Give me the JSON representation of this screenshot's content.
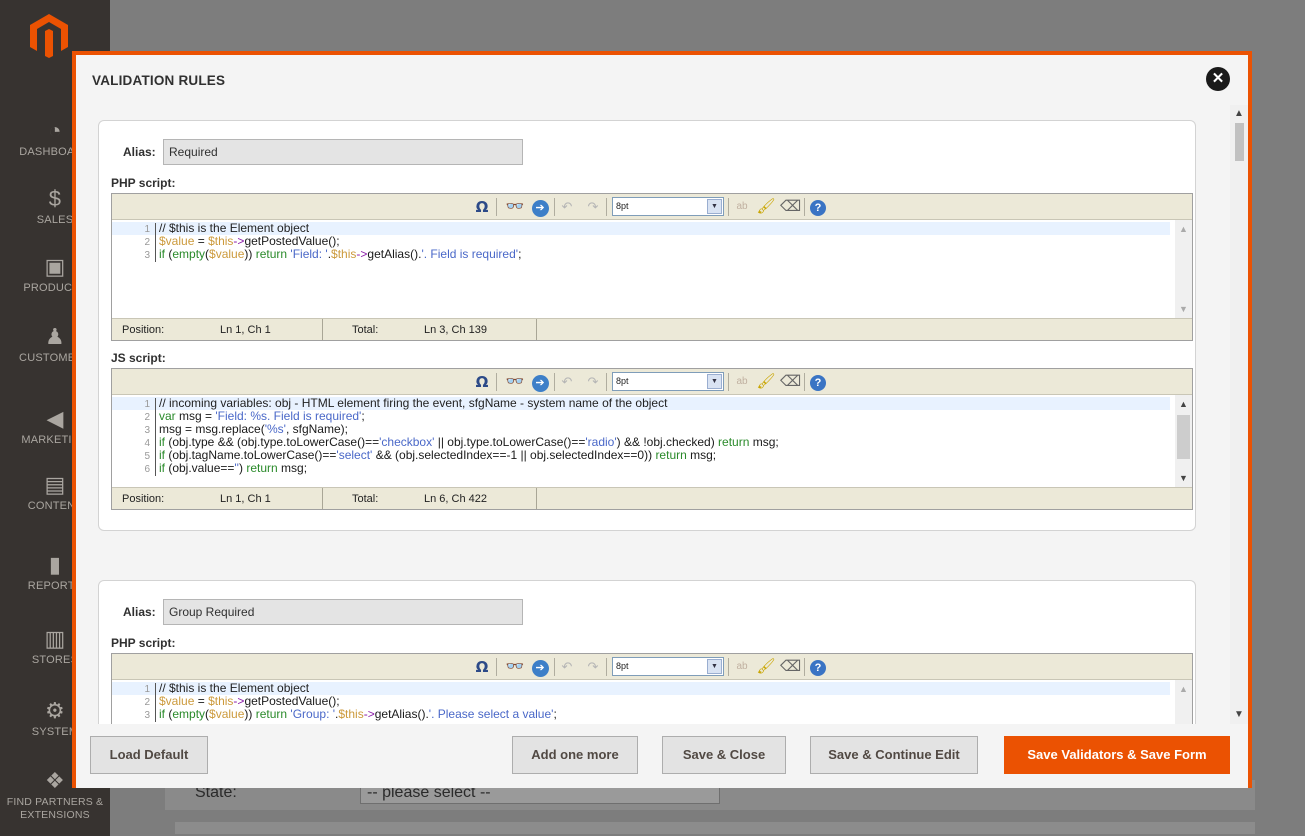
{
  "admin": {
    "nav": [
      {
        "label": "DASHBOARD",
        "icon": "dashboard-icon"
      },
      {
        "label": "SALES",
        "icon": "dollar-icon"
      },
      {
        "label": "PRODUCTS",
        "icon": "box-icon"
      },
      {
        "label": "CUSTOMERS",
        "icon": "person-icon"
      },
      {
        "label": "MARKETING",
        "icon": "megaphone-icon"
      },
      {
        "label": "CONTENT",
        "icon": "layout-icon"
      },
      {
        "label": "REPORTS",
        "icon": "bar-chart-icon"
      },
      {
        "label": "STORES",
        "icon": "store-icon"
      },
      {
        "label": "SYSTEM",
        "icon": "gear-icon"
      },
      {
        "label": "FIND PARTNERS & EXTENSIONS",
        "icon": "boxes-icon"
      }
    ],
    "state_label": "State:",
    "state_select": "-- please select --"
  },
  "modal": {
    "title": "VALIDATION RULES",
    "close_glyph": "✕"
  },
  "toolbar": {
    "omega": "Ω",
    "find": "👓",
    "goto": "➔",
    "undo": "↶",
    "redo": "↷",
    "font_size": "8pt",
    "wrap": "ab",
    "brush": "🖌",
    "eraser": "⌫",
    "help": "?"
  },
  "labels": {
    "alias": "Alias:",
    "php_script": "PHP script:",
    "js_script": "JS script:",
    "position": "Position:",
    "total": "Total:"
  },
  "rules": [
    {
      "alias": "Required",
      "php": {
        "position": "Ln 1, Ch 1",
        "total": "Ln 3, Ch 139",
        "lines": [
          [
            {
              "t": "// $this is the Element object",
              "c": "c-com"
            }
          ],
          [
            {
              "t": "$value",
              "c": "c-var"
            },
            {
              "t": " = ",
              "c": "c-plain"
            },
            {
              "t": "$this",
              "c": "c-var"
            },
            {
              "t": "->",
              "c": "c-op"
            },
            {
              "t": "getPostedValue",
              "c": "c-fn"
            },
            {
              "t": "();",
              "c": "c-plain"
            }
          ],
          [
            {
              "t": "if",
              "c": "c-kw"
            },
            {
              "t": " (",
              "c": "c-plain"
            },
            {
              "t": "empty",
              "c": "c-kw"
            },
            {
              "t": "(",
              "c": "c-plain"
            },
            {
              "t": "$value",
              "c": "c-var"
            },
            {
              "t": ")) ",
              "c": "c-plain"
            },
            {
              "t": "return",
              "c": "c-kw"
            },
            {
              "t": " 'Field: '",
              "c": "c-str"
            },
            {
              "t": ".",
              "c": "c-plain"
            },
            {
              "t": "$this",
              "c": "c-var"
            },
            {
              "t": "->",
              "c": "c-op"
            },
            {
              "t": "getAlias",
              "c": "c-fn"
            },
            {
              "t": "().",
              "c": "c-plain"
            },
            {
              "t": "'. Field is required'",
              "c": "c-str"
            },
            {
              "t": ";",
              "c": "c-plain"
            }
          ]
        ]
      },
      "js": {
        "position": "Ln 1, Ch 1",
        "total": "Ln 6, Ch 422",
        "lines": [
          [
            {
              "t": "// incoming variables: obj - HTML element firing the event, sfgName - system name of the object",
              "c": "c-com"
            }
          ],
          [
            {
              "t": "var",
              "c": "c-kw"
            },
            {
              "t": " msg = ",
              "c": "c-plain"
            },
            {
              "t": "'Field: %s. Field is required'",
              "c": "c-str"
            },
            {
              "t": ";",
              "c": "c-plain"
            }
          ],
          [
            {
              "t": "msg = msg.replace(",
              "c": "c-plain"
            },
            {
              "t": "'%s'",
              "c": "c-str"
            },
            {
              "t": ", sfgName);",
              "c": "c-plain"
            }
          ],
          [
            {
              "t": "if",
              "c": "c-kw"
            },
            {
              "t": " (obj.type && (obj.type.toLowerCase()==",
              "c": "c-plain"
            },
            {
              "t": "'checkbox'",
              "c": "c-str"
            },
            {
              "t": " || obj.type.toLowerCase()==",
              "c": "c-plain"
            },
            {
              "t": "'radio'",
              "c": "c-str"
            },
            {
              "t": ") && !obj.checked) ",
              "c": "c-plain"
            },
            {
              "t": "return",
              "c": "c-kw"
            },
            {
              "t": " msg;",
              "c": "c-plain"
            }
          ],
          [
            {
              "t": "if",
              "c": "c-kw"
            },
            {
              "t": " (obj.tagName.toLowerCase()==",
              "c": "c-plain"
            },
            {
              "t": "'select'",
              "c": "c-str"
            },
            {
              "t": " && (obj.selectedIndex==-1 || obj.selectedIndex==0)) ",
              "c": "c-plain"
            },
            {
              "t": "return",
              "c": "c-kw"
            },
            {
              "t": " msg;",
              "c": "c-plain"
            }
          ],
          [
            {
              "t": "if",
              "c": "c-kw"
            },
            {
              "t": " (obj.value==",
              "c": "c-plain"
            },
            {
              "t": "''",
              "c": "c-str"
            },
            {
              "t": ") ",
              "c": "c-plain"
            },
            {
              "t": "return",
              "c": "c-kw"
            },
            {
              "t": " msg;",
              "c": "c-plain"
            }
          ]
        ]
      }
    },
    {
      "alias": "Group Required",
      "php": {
        "lines": [
          [
            {
              "t": "// $this is the Element object",
              "c": "c-com"
            }
          ],
          [
            {
              "t": "$value",
              "c": "c-var"
            },
            {
              "t": " = ",
              "c": "c-plain"
            },
            {
              "t": "$this",
              "c": "c-var"
            },
            {
              "t": "->",
              "c": "c-op"
            },
            {
              "t": "getPostedValue",
              "c": "c-fn"
            },
            {
              "t": "();",
              "c": "c-plain"
            }
          ],
          [
            {
              "t": "if",
              "c": "c-kw"
            },
            {
              "t": " (",
              "c": "c-plain"
            },
            {
              "t": "empty",
              "c": "c-kw"
            },
            {
              "t": "(",
              "c": "c-plain"
            },
            {
              "t": "$value",
              "c": "c-var"
            },
            {
              "t": ")) ",
              "c": "c-plain"
            },
            {
              "t": "return",
              "c": "c-kw"
            },
            {
              "t": " 'Group: '",
              "c": "c-str"
            },
            {
              "t": ".",
              "c": "c-plain"
            },
            {
              "t": "$this",
              "c": "c-var"
            },
            {
              "t": "->",
              "c": "c-op"
            },
            {
              "t": "getAlias",
              "c": "c-fn"
            },
            {
              "t": "().",
              "c": "c-plain"
            },
            {
              "t": "'. Please select a value'",
              "c": "c-str"
            },
            {
              "t": ";",
              "c": "c-plain"
            }
          ]
        ]
      }
    }
  ],
  "footer": {
    "load_default": "Load Default",
    "add_one_more": "Add one more",
    "save_close": "Save & Close",
    "save_continue": "Save & Continue Edit",
    "save_validators": "Save Validators & Save Form"
  },
  "colors": {
    "accent": "#eb5202",
    "sidebar_bg": "#373330"
  }
}
